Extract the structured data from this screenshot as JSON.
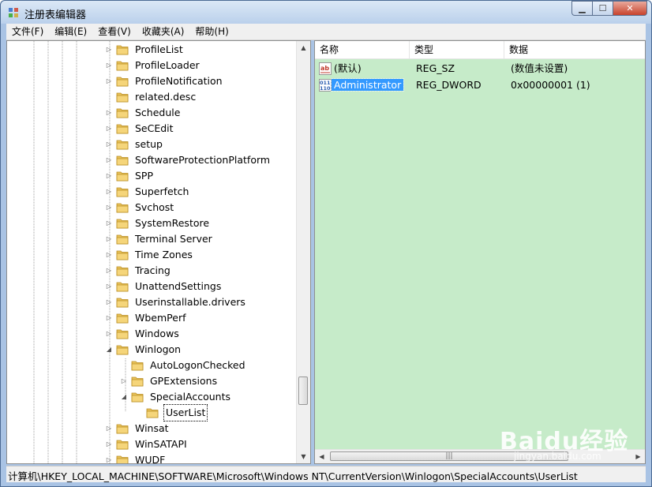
{
  "window": {
    "title": "注册表编辑器"
  },
  "menu": [
    "文件(F)",
    "编辑(E)",
    "查看(V)",
    "收藏夹(A)",
    "帮助(H)"
  ],
  "tree": {
    "items": [
      {
        "label": "ProfileList",
        "expander": "▷",
        "level": 0
      },
      {
        "label": "ProfileLoader",
        "expander": "▷",
        "level": 0
      },
      {
        "label": "ProfileNotification",
        "expander": "▷",
        "level": 0
      },
      {
        "label": "related.desc",
        "expander": "",
        "level": 0
      },
      {
        "label": "Schedule",
        "expander": "▷",
        "level": 0
      },
      {
        "label": "SeCEdit",
        "expander": "▷",
        "level": 0
      },
      {
        "label": "setup",
        "expander": "▷",
        "level": 0
      },
      {
        "label": "SoftwareProtectionPlatform",
        "expander": "▷",
        "level": 0
      },
      {
        "label": "SPP",
        "expander": "▷",
        "level": 0
      },
      {
        "label": "Superfetch",
        "expander": "▷",
        "level": 0
      },
      {
        "label": "Svchost",
        "expander": "▷",
        "level": 0
      },
      {
        "label": "SystemRestore",
        "expander": "▷",
        "level": 0
      },
      {
        "label": "Terminal Server",
        "expander": "▷",
        "level": 0
      },
      {
        "label": "Time Zones",
        "expander": "▷",
        "level": 0
      },
      {
        "label": "Tracing",
        "expander": "▷",
        "level": 0
      },
      {
        "label": "UnattendSettings",
        "expander": "▷",
        "level": 0
      },
      {
        "label": "Userinstallable.drivers",
        "expander": "▷",
        "level": 0
      },
      {
        "label": "WbemPerf",
        "expander": "▷",
        "level": 0
      },
      {
        "label": "Windows",
        "expander": "▷",
        "level": 0
      },
      {
        "label": "Winlogon",
        "expander": "◢",
        "level": 0
      },
      {
        "label": "AutoLogonChecked",
        "expander": "",
        "level": 1
      },
      {
        "label": "GPExtensions",
        "expander": "▷",
        "level": 1
      },
      {
        "label": "SpecialAccounts",
        "expander": "◢",
        "level": 1
      },
      {
        "label": "UserList",
        "expander": "",
        "level": 2,
        "selected": true
      },
      {
        "label": "Winsat",
        "expander": "▷",
        "level": 0
      },
      {
        "label": "WinSATAPI",
        "expander": "▷",
        "level": 0
      },
      {
        "label": "WUDF",
        "expander": "▷",
        "level": 0
      }
    ]
  },
  "list": {
    "columns": [
      "名称",
      "类型",
      "数据"
    ],
    "rows": [
      {
        "icon": "string-value-icon",
        "name": "(默认)",
        "type": "REG_SZ",
        "data": "(数值未设置)"
      },
      {
        "icon": "dword-value-icon",
        "name": "Administrator",
        "type": "REG_DWORD",
        "data": "0x00000001 (1)",
        "selected": true
      }
    ]
  },
  "status": {
    "path": "计算机\\HKEY_LOCAL_MACHINE\\SOFTWARE\\Microsoft\\Windows NT\\CurrentVersion\\Winlogon\\SpecialAccounts\\UserList"
  },
  "watermark": {
    "text": "Baidu经验",
    "sub": "jingyan.baidu.com"
  },
  "colors": {
    "list_bg": "#c6ebc9",
    "selection": "#3399ff",
    "folder": "#e8c15a"
  }
}
